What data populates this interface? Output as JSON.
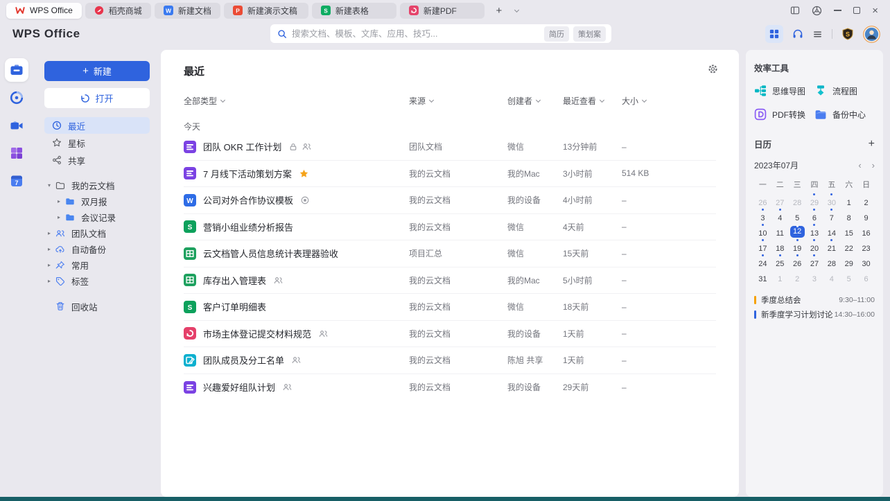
{
  "tabbar": {
    "tabs": [
      {
        "label": "WPS Office",
        "icon": "wps-logo",
        "active": true
      },
      {
        "label": "稻壳商城",
        "icon": "docer",
        "active": false
      },
      {
        "label": "新建文档",
        "icon": "writer",
        "active": false
      },
      {
        "label": "新建演示文稿",
        "icon": "ppt",
        "active": false
      },
      {
        "label": "新建表格",
        "icon": "sheet",
        "active": false
      },
      {
        "label": "新建PDF",
        "icon": "pdf",
        "active": false
      }
    ],
    "add_label": "+"
  },
  "window_controls": [
    "split-view",
    "skin",
    "minimize",
    "maximize",
    "close"
  ],
  "toolbar": {
    "logo": "WPS Office",
    "search": {
      "placeholder": "搜索文档、模板、文库、应用、技巧...",
      "tags": [
        "简历",
        "策划案"
      ]
    },
    "right_icons": [
      "apps-grid",
      "headset",
      "menu",
      "vip-badge",
      "avatar"
    ]
  },
  "rail": {
    "items": [
      {
        "icon": "rail-docs",
        "active": true
      },
      {
        "icon": "rail-docer",
        "active": false
      },
      {
        "icon": "rail-meeting",
        "active": false
      },
      {
        "icon": "rail-apps",
        "active": false
      },
      {
        "icon": "rail-calendar",
        "active": false
      }
    ]
  },
  "sidebar": {
    "new_button": "新建",
    "open_button": "打开",
    "nav": [
      {
        "label": "最近",
        "icon": "clock",
        "active": true
      },
      {
        "label": "星标",
        "icon": "star-outline",
        "active": false
      },
      {
        "label": "共享",
        "icon": "share",
        "active": false
      }
    ],
    "tree": [
      {
        "label": "我的云文档",
        "icon": "folder-outline",
        "arrow": "down",
        "child": false
      },
      {
        "label": "双月报",
        "icon": "folder-blue",
        "arrow": "right",
        "child": true
      },
      {
        "label": "会议记录",
        "icon": "folder-blue",
        "arrow": "right",
        "child": true
      },
      {
        "label": "团队文档",
        "icon": "team",
        "arrow": "right",
        "child": false
      },
      {
        "label": "自动备份",
        "icon": "cloud",
        "arrow": "right",
        "child": false
      },
      {
        "label": "常用",
        "icon": "pin",
        "arrow": "right",
        "child": false
      },
      {
        "label": "标签",
        "icon": "tag",
        "arrow": "right",
        "child": false
      }
    ],
    "trash": {
      "label": "回收站",
      "icon": "trash"
    }
  },
  "main": {
    "title": "最近",
    "filters": [
      "全部类型",
      "来源",
      "创建者",
      "最近查看",
      "大小"
    ],
    "group": "今天",
    "files": [
      {
        "icon": "doc",
        "title": "团队 OKR 工作计划",
        "badges": [
          "lock",
          "people"
        ],
        "source": "团队文档",
        "creator": "微信",
        "viewed": "13分钟前",
        "size": "–"
      },
      {
        "icon": "doc",
        "title": "7 月线下活动策划方案",
        "badges": [
          "star"
        ],
        "source": "我的云文档",
        "creator": "我的Mac",
        "viewed": "3小时前",
        "size": "514 KB"
      },
      {
        "icon": "word",
        "title": "公司对外合作协议模板",
        "badges": [
          "check-circle"
        ],
        "source": "我的云文档",
        "creator": "我的设备",
        "viewed": "4小时前",
        "size": "–"
      },
      {
        "icon": "sheet-s",
        "title": "营销小组业绩分析报告",
        "badges": [],
        "source": "我的云文档",
        "creator": "微信",
        "viewed": "4天前",
        "size": "–"
      },
      {
        "icon": "sheet-grid",
        "title": "云文档管人员信息统计表理器验收",
        "badges": [],
        "source": "项目汇总",
        "creator": "微信",
        "viewed": "15天前",
        "size": "–"
      },
      {
        "icon": "sheet-grid",
        "title": "库存出入管理表",
        "badges": [
          "people"
        ],
        "source": "我的云文档",
        "creator": "我的Mac",
        "viewed": "5小时前",
        "size": "–"
      },
      {
        "icon": "sheet-s",
        "title": "客户订单明细表",
        "badges": [],
        "source": "我的云文档",
        "creator": "微信",
        "viewed": "18天前",
        "size": "–"
      },
      {
        "icon": "pdf-file",
        "title": "市场主体登记提交材料规范",
        "badges": [
          "people"
        ],
        "source": "我的云文档",
        "creator": "我的设备",
        "viewed": "1天前",
        "size": "–"
      },
      {
        "icon": "form",
        "title": "团队成员及分工名单",
        "badges": [
          "people"
        ],
        "source": "我的云文档",
        "creator": "陈旭 共享",
        "viewed": "1天前",
        "size": "–"
      },
      {
        "icon": "doc",
        "title": "兴趣爱好组队计划",
        "badges": [
          "people"
        ],
        "source": "我的云文档",
        "creator": "我的设备",
        "viewed": "29天前",
        "size": "–"
      }
    ]
  },
  "tools": {
    "title": "效率工具",
    "items": [
      {
        "label": "思维导图",
        "icon": "mindmap"
      },
      {
        "label": "流程图",
        "icon": "flowchart"
      },
      {
        "label": "PDF转换",
        "icon": "pdf-convert"
      },
      {
        "label": "备份中心",
        "icon": "backup"
      }
    ]
  },
  "calendar": {
    "title": "日历",
    "add_label": "+",
    "month": "2023年07月",
    "prev": "‹",
    "next": "›",
    "weekdays": [
      "一",
      "二",
      "三",
      "四",
      "五",
      "六",
      "日"
    ],
    "days": [
      {
        "num": 26,
        "muted": true
      },
      {
        "num": 27,
        "muted": true
      },
      {
        "num": 28,
        "muted": true
      },
      {
        "num": 29,
        "muted": true,
        "dot": true
      },
      {
        "num": 30,
        "muted": true,
        "dot": true
      },
      {
        "num": 1
      },
      {
        "num": 2
      },
      {
        "num": 3,
        "dot": true
      },
      {
        "num": 4,
        "dot": true
      },
      {
        "num": 5
      },
      {
        "num": 6,
        "dot": true
      },
      {
        "num": 7,
        "dot": true
      },
      {
        "num": 8
      },
      {
        "num": 9
      },
      {
        "num": 10,
        "dot": true
      },
      {
        "num": 11
      },
      {
        "num": 12,
        "dot": true,
        "selected": true
      },
      {
        "num": 13,
        "dot": true
      },
      {
        "num": 14
      },
      {
        "num": 15
      },
      {
        "num": 16
      },
      {
        "num": 17,
        "dot": true
      },
      {
        "num": 18
      },
      {
        "num": 19,
        "dot": true
      },
      {
        "num": 20,
        "dot": true
      },
      {
        "num": 21,
        "dot": true
      },
      {
        "num": 22
      },
      {
        "num": 23
      },
      {
        "num": 24,
        "dot": true
      },
      {
        "num": 25,
        "dot": true
      },
      {
        "num": 26,
        "dot": true
      },
      {
        "num": 27,
        "dot": true
      },
      {
        "num": 28
      },
      {
        "num": 29
      },
      {
        "num": 30
      },
      {
        "num": 31
      },
      {
        "num": 1,
        "muted": true
      },
      {
        "num": 2,
        "muted": true
      },
      {
        "num": 3,
        "muted": true
      },
      {
        "num": 4,
        "muted": true
      },
      {
        "num": 5,
        "muted": true
      },
      {
        "num": 6,
        "muted": true
      }
    ],
    "events": [
      {
        "title": "季度总结会",
        "time": "9:30–11:00",
        "color": "#f5a100"
      },
      {
        "title": "新季度学习计划讨论",
        "time": "14:30–16:00",
        "color": "#2f63de"
      }
    ]
  }
}
